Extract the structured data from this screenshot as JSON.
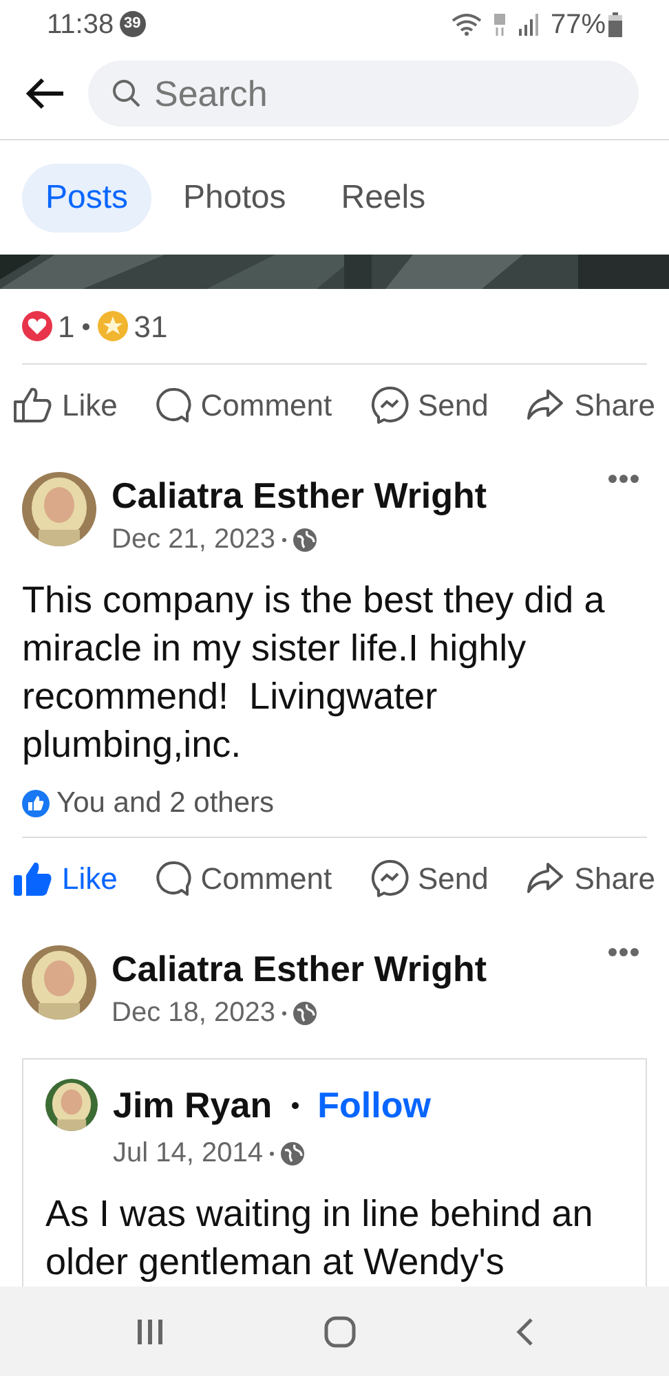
{
  "status_bar": {
    "time": "11:38",
    "notification_count": "39",
    "battery": "77%"
  },
  "search": {
    "placeholder": "Search"
  },
  "tabs": [
    {
      "label": "Posts",
      "selected": true
    },
    {
      "label": "Photos",
      "selected": false
    },
    {
      "label": "Reels",
      "selected": false
    }
  ],
  "top_post": {
    "reactions": [
      {
        "kind": "love",
        "count": "1"
      },
      {
        "kind": "care",
        "count": "31"
      }
    ],
    "actions": [
      {
        "kind": "like",
        "label": "Like",
        "active": false
      },
      {
        "kind": "comment",
        "label": "Comment",
        "active": false
      },
      {
        "kind": "send",
        "label": "Send",
        "active": false
      },
      {
        "kind": "share",
        "label": "Share",
        "active": false
      }
    ]
  },
  "posts": [
    {
      "author": "Caliatra Esther Wright",
      "date": "Dec 21, 2023",
      "text": "This company is the best they did a miracle in my sister life.I highly recommend!  Livingwater plumbing,inc.",
      "likes_summary": "You and 2 others",
      "actions": [
        {
          "kind": "like",
          "label": "Like",
          "active": true
        },
        {
          "kind": "comment",
          "label": "Comment",
          "active": false
        },
        {
          "kind": "send",
          "label": "Send",
          "active": false
        },
        {
          "kind": "share",
          "label": "Share",
          "active": false
        }
      ]
    },
    {
      "author": "Caliatra Esther Wright",
      "date": "Dec 18, 2023",
      "shared": {
        "author": "Jim Ryan",
        "follow": "Follow",
        "date": "Jul 14, 2014",
        "text": "As I was waiting in line behind an older gentleman at Wendy's"
      }
    }
  ]
}
